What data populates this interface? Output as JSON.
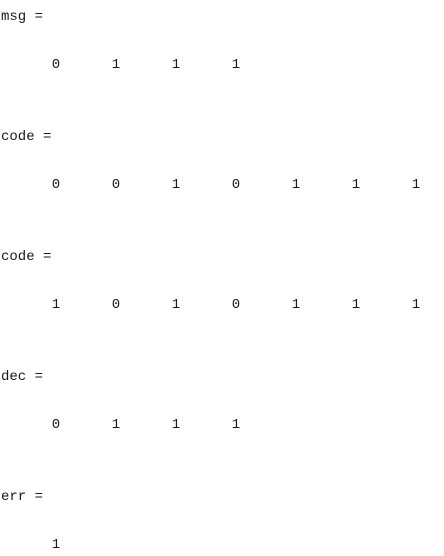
{
  "outputs": [
    {
      "label": "msg =",
      "values": [
        "0",
        "1",
        "1",
        "1"
      ]
    },
    {
      "label": "code =",
      "values": [
        "0",
        "0",
        "1",
        "0",
        "1",
        "1",
        "1"
      ]
    },
    {
      "label": "code =",
      "values": [
        "1",
        "0",
        "1",
        "0",
        "1",
        "1",
        "1"
      ]
    },
    {
      "label": "dec =",
      "values": [
        "0",
        "1",
        "1",
        "1"
      ]
    },
    {
      "label": "err =",
      "values": [
        "1"
      ]
    }
  ]
}
